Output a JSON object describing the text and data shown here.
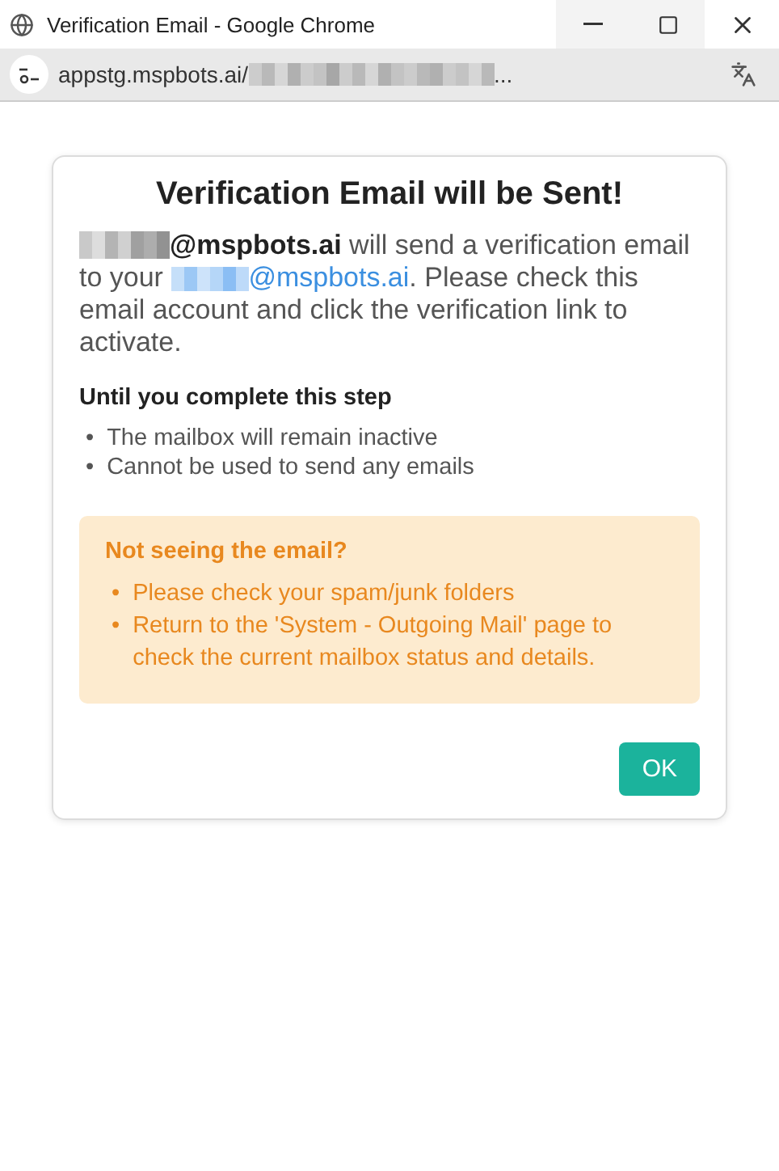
{
  "window": {
    "title": "Verification Email - Google Chrome"
  },
  "address_bar": {
    "url": "appstg.mspbots.ai/",
    "ellipsis": "..."
  },
  "dialog": {
    "title": "Verification Email will be Sent!",
    "message": {
      "sender": "@mspbots.ai",
      "middle": " will send a verification email to your ",
      "recipient": "@mspbots.ai",
      "end": ". Please check this email account and click the verification link to activate."
    },
    "section_heading": "Until you complete this step",
    "consequences": [
      {
        "bullet": "•",
        "text": "The mailbox will remain inactive"
      },
      {
        "bullet": "•",
        "text": "Cannot be used to send any emails"
      }
    ],
    "notice": {
      "heading": "Not seeing the email?",
      "items": [
        {
          "bullet": "•",
          "text": "Please check your spam/junk folders"
        },
        {
          "bullet": "•",
          "text": "Return to the 'System - Outgoing Mail' page to check the current mailbox status and details."
        }
      ]
    },
    "buttons": [
      {
        "label": "OK",
        "kind": "primary"
      }
    ]
  }
}
